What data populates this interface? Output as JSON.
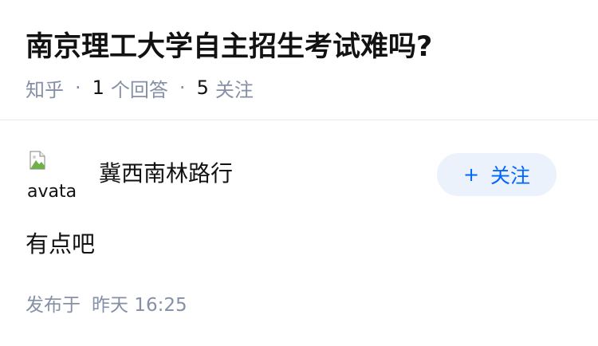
{
  "question": {
    "title": "南京理工大学自主招生考试难吗?",
    "source": "知乎",
    "answer_count": "1",
    "answer_label": "个回答",
    "follower_count": "5",
    "follower_label": "关注"
  },
  "answer": {
    "author": {
      "name": "冀西南林路行",
      "avatar_alt": "avatar"
    },
    "follow_button": {
      "icon": "plus-icon",
      "label": "关注"
    },
    "content": "有点吧",
    "published_prefix": "发布于",
    "published_time": "昨天 16:25"
  },
  "colors": {
    "text": "#121212",
    "muted": "#8590a6",
    "accent": "#0066ff",
    "button_bg": "#ebf2fb",
    "divider": "#ebebeb"
  }
}
